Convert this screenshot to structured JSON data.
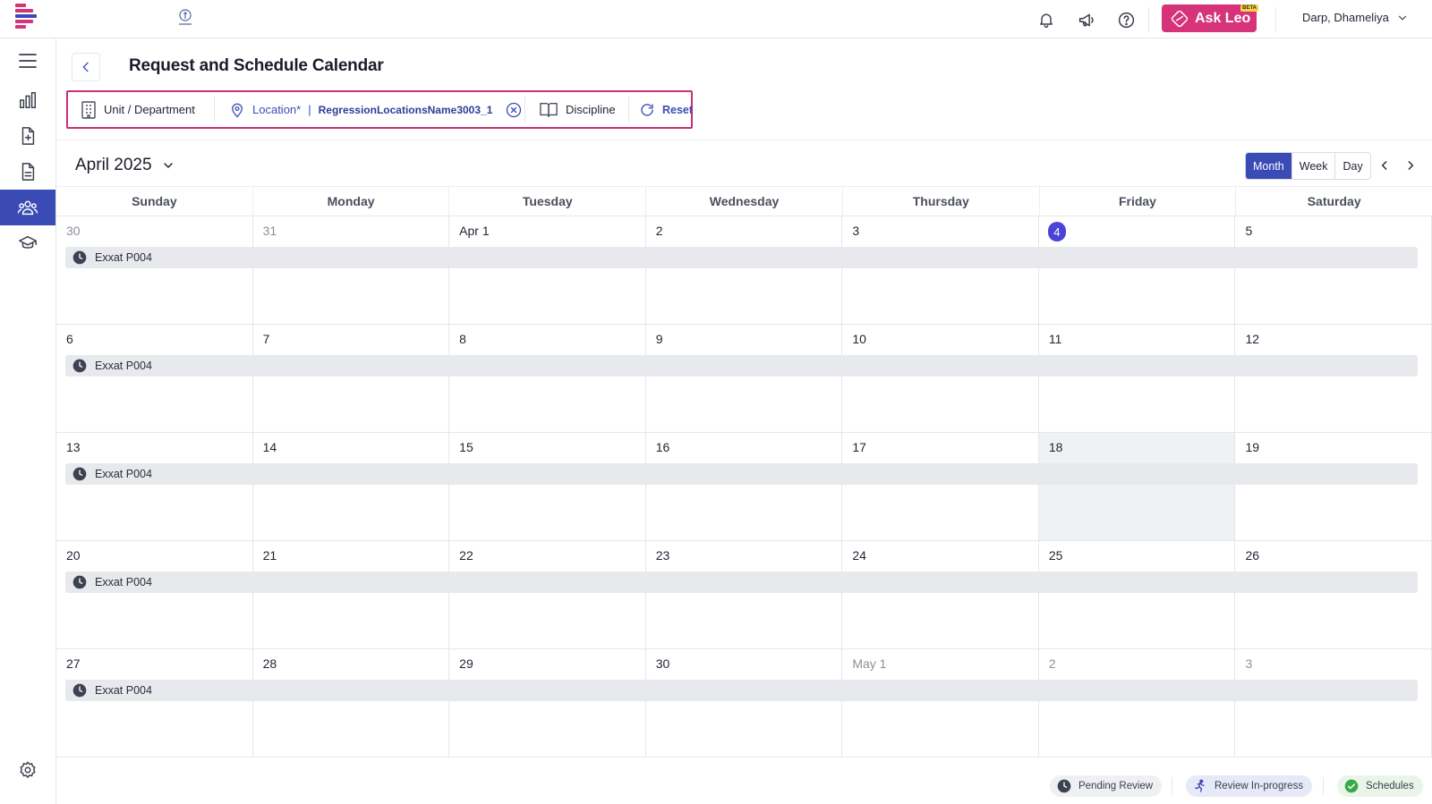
{
  "topbar": {
    "ask_leo_label": "Ask Leo",
    "ask_leo_badge": "BETA",
    "user_name": "Darp, Dhameliya",
    "icons": [
      "bell-icon",
      "megaphone-icon",
      "help-icon"
    ]
  },
  "sidebar": {
    "items": [
      "menu-icon",
      "analytics-icon",
      "add-document-icon",
      "document-icon",
      "people-icon",
      "graduation-cap-icon",
      "settings-icon"
    ],
    "active": "people-icon"
  },
  "page": {
    "title": "Request and Schedule Calendar"
  },
  "filters": {
    "unit_label": "Unit / Department",
    "location_label": "Location*",
    "location_separator": "|",
    "location_value": "RegressionLocationsName3003_1",
    "discipline_label": "Discipline",
    "reset_label": "Reset"
  },
  "calendar": {
    "month_label": "April 2025",
    "views": [
      "Month",
      "Week",
      "Day"
    ],
    "active_view": "Month",
    "weekdays": [
      "Sunday",
      "Monday",
      "Tuesday",
      "Wednesday",
      "Thursday",
      "Friday",
      "Saturday"
    ],
    "weeks": [
      {
        "days": [
          "30",
          "31",
          "Apr 1",
          "2",
          "3",
          "4",
          "5"
        ],
        "muted": [
          0,
          1
        ],
        "today": 5,
        "shaded": [],
        "event": "Exxat P004"
      },
      {
        "days": [
          "6",
          "7",
          "8",
          "9",
          "10",
          "11",
          "12"
        ],
        "muted": [],
        "today": -1,
        "shaded": [],
        "event": "Exxat P004"
      },
      {
        "days": [
          "13",
          "14",
          "15",
          "16",
          "17",
          "18",
          "19"
        ],
        "muted": [],
        "today": -1,
        "shaded": [
          5
        ],
        "event": "Exxat P004"
      },
      {
        "days": [
          "20",
          "21",
          "22",
          "23",
          "24",
          "25",
          "26"
        ],
        "muted": [],
        "today": -1,
        "shaded": [],
        "event": "Exxat P004"
      },
      {
        "days": [
          "27",
          "28",
          "29",
          "30",
          "May 1",
          "2",
          "3"
        ],
        "muted": [
          4,
          5,
          6
        ],
        "today": -1,
        "shaded": [],
        "event": "Exxat P004"
      }
    ]
  },
  "legend": {
    "pending": "Pending Review",
    "in_progress": "Review In-progress",
    "schedules": "Schedules"
  },
  "colors": {
    "primary": "#3a4bb5",
    "ask_leo": "#d6337a",
    "filter_outline": "#c8307a",
    "today": "#4a44d6",
    "event_bar": "#e8e9ed"
  }
}
